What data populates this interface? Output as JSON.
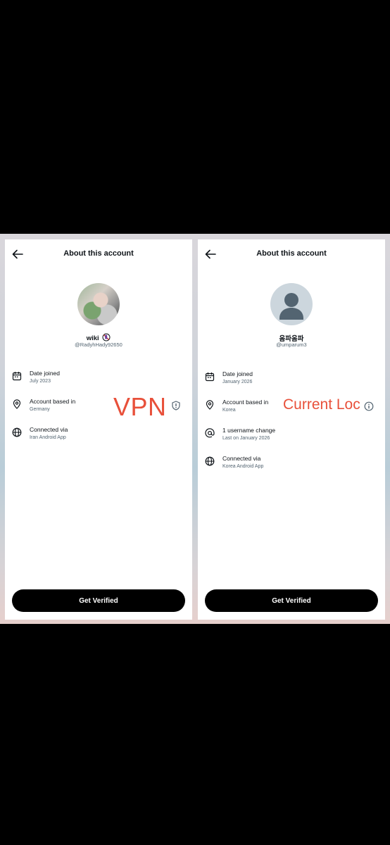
{
  "left_panel": {
    "title": "About this account",
    "name": "wiki",
    "handle": "@RadyhHady92650",
    "rows": [
      {
        "label": "Date joined",
        "value": "July 2023"
      },
      {
        "label": "Account based in",
        "value": "Germany"
      },
      {
        "label": "Connected via",
        "value": "Iran Android App"
      }
    ],
    "annotation": "VPN",
    "button": "Get Verified"
  },
  "right_panel": {
    "title": "About this account",
    "name": "옴파옴파",
    "handle": "@umparum3",
    "rows": [
      {
        "label": "Date joined",
        "value": "January 2026"
      },
      {
        "label": "Account based in",
        "value": "Korea"
      },
      {
        "label": "1 username change",
        "value": "Last on January 2026"
      },
      {
        "label": "Connected via",
        "value": "Korea Android App"
      }
    ],
    "annotation": "Current Loc",
    "button": "Get Verified"
  },
  "colors": {
    "annotation": "#e8503a",
    "button_bg": "#000000",
    "secondary_text": "#536471"
  },
  "icons": [
    "back-arrow-icon",
    "calendar-icon",
    "location-pin-icon",
    "shield-alert-icon",
    "info-icon",
    "at-sign-icon",
    "globe-icon",
    "default-avatar-icon"
  ]
}
